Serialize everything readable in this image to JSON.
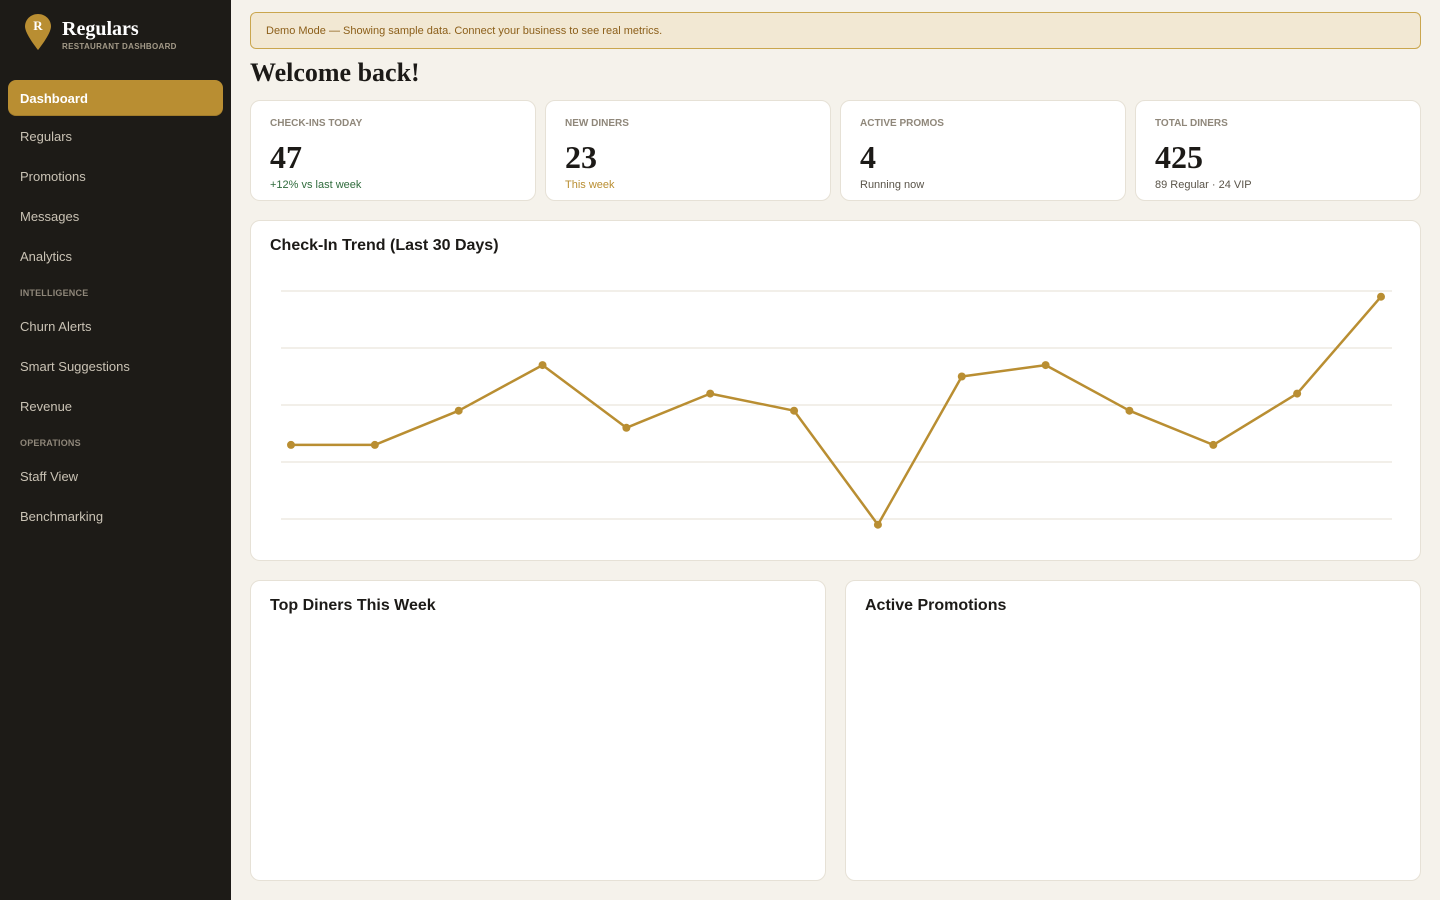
{
  "brand": {
    "logo_letter": "R",
    "name": "Regulars",
    "subtitle": "RESTAURANT DASHBOARD",
    "accent_color": "#b98e32"
  },
  "sidebar": {
    "items": [
      {
        "label": "Dashboard",
        "active": true
      },
      {
        "label": "Regulars",
        "active": false
      },
      {
        "label": "Promotions",
        "active": false
      },
      {
        "label": "Messages",
        "active": false
      },
      {
        "label": "Analytics",
        "active": false
      }
    ],
    "section_intelligence": "INTELLIGENCE",
    "intelligence_items": [
      {
        "label": "Churn Alerts"
      },
      {
        "label": "Smart Suggestions"
      },
      {
        "label": "Revenue"
      }
    ],
    "section_operations": "OPERATIONS",
    "operations_items": [
      {
        "label": "Staff View"
      },
      {
        "label": "Benchmarking"
      }
    ]
  },
  "banner": {
    "text": "Demo Mode — Showing sample data. Connect your business to see real metrics."
  },
  "welcome": "Welcome back!",
  "stats": [
    {
      "label": "CHECK-INS TODAY",
      "value": "47",
      "sub": "+12% vs last week",
      "sub_color": "#2f6b3c"
    },
    {
      "label": "NEW DINERS",
      "value": "23",
      "sub": "This week",
      "sub_color": "#b98e32"
    },
    {
      "label": "ACTIVE PROMOS",
      "value": "4",
      "sub": "Running now",
      "sub_color": "#5a5449"
    },
    {
      "label": "TOTAL DINERS",
      "value": "425",
      "sub": "89 Regular · 24 VIP",
      "sub_color": "#5a5449"
    }
  ],
  "trend_panel": {
    "title": "Check-In Trend (Last 30 Days)"
  },
  "top_diners_panel": {
    "title": "Top Diners This Week"
  },
  "active_promos_panel": {
    "title": "Active Promotions"
  },
  "chart_data": {
    "type": "line",
    "title": "Check-In Trend (Last 30 Days)",
    "xlabel": "",
    "ylabel": "",
    "x": [
      1,
      2,
      3,
      4,
      5,
      6,
      7,
      8,
      9,
      10,
      11,
      12,
      13,
      14
    ],
    "values": [
      33,
      33,
      39,
      47,
      36,
      42,
      39,
      19,
      45,
      47,
      39,
      33,
      42,
      59
    ],
    "ylim": [
      20,
      60
    ],
    "grid": true,
    "legend": "none",
    "line_color": "#b98e32"
  }
}
